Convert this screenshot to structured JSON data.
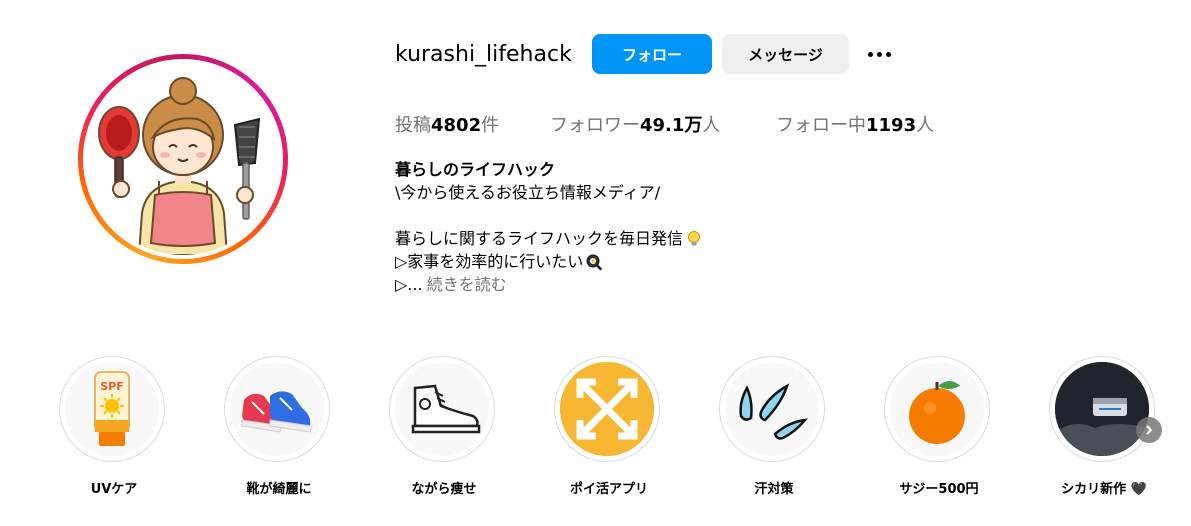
{
  "profile": {
    "username": "kurashi_lifehack",
    "follow_label": "フォロー",
    "message_label": "メッセージ",
    "stats": {
      "posts_prefix": "投稿",
      "posts_value": "4802",
      "posts_suffix": "件",
      "followers_prefix": "フォロワー",
      "followers_value": "49.1万",
      "followers_suffix": "人",
      "following_prefix": "フォロー中",
      "following_value": "1193",
      "following_suffix": "人"
    },
    "bio": {
      "name": "暮らしのライフハック",
      "line1": "\\今から使えるお役立ち情報メディア/",
      "line2": "暮らしに関するライフハックを毎日発信",
      "line3": "▷家事を効率的に行いたい",
      "line4_prefix": "▷...",
      "more_label": "続きを読む"
    }
  },
  "highlights": [
    {
      "label": "UVケア",
      "icon": "sunscreen-icon"
    },
    {
      "label": "靴が綺麗に",
      "icon": "sneakers-icon"
    },
    {
      "label": "ながら痩せ",
      "icon": "hightop-shoe-icon"
    },
    {
      "label": "ポイ活アプリ",
      "icon": "poikatsu-app-icon"
    },
    {
      "label": "汗対策",
      "icon": "sweat-drops-icon"
    },
    {
      "label": "サジー500円",
      "icon": "orange-icon"
    },
    {
      "label": "シカリ新作 🖤",
      "icon": "cosmetic-jar-icon"
    }
  ],
  "colors": {
    "accent": "#0095f6",
    "secondary_button": "#efefef",
    "muted_text": "#737373",
    "ring_gradient": [
      "#f9a825",
      "#e91e63",
      "#d81b9c"
    ]
  }
}
